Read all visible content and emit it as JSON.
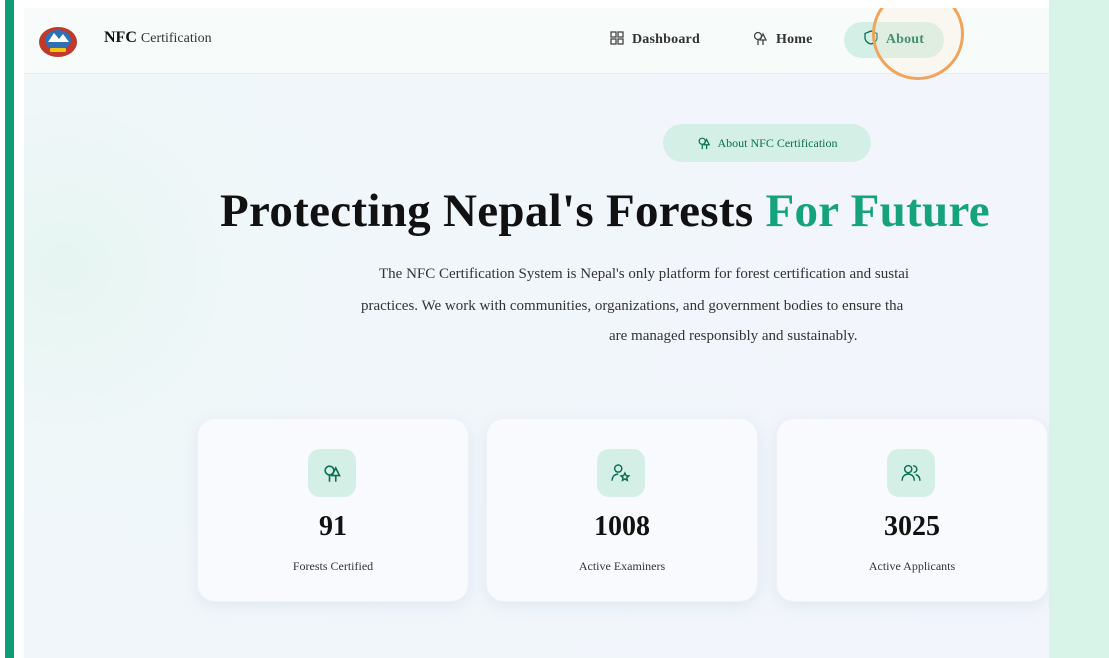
{
  "header": {
    "brand_bold": "NFC",
    "brand_rest": "Certification",
    "nav": [
      {
        "label": "Dashboard",
        "icon": "grid-icon"
      },
      {
        "label": "Home",
        "icon": "trees-icon"
      },
      {
        "label": "About",
        "icon": "shield-icon",
        "active": true
      }
    ]
  },
  "hero": {
    "pill": "About NFC Certification",
    "title_main": "Protecting Nepal's Forests",
    "title_accent": "For Future",
    "desc_line1": "The NFC Certification System is Nepal's only platform for forest certification and sustai",
    "desc_line2": "practices. We work with communities, organizations, and government bodies to ensure tha",
    "desc_line3": "are managed responsibly and sustainably."
  },
  "stats": [
    {
      "value": "91",
      "label": "Forests Certified",
      "icon": "trees-icon"
    },
    {
      "value": "1008",
      "label": "Active Examiners",
      "icon": "user-star-icon"
    },
    {
      "value": "3025",
      "label": "Active Applicants",
      "icon": "users-icon"
    }
  ],
  "colors": {
    "accent": "#14a37c",
    "accent_dark": "#0a6f53",
    "pill_bg": "#d4efe6",
    "side_accent": "#0f9b76",
    "cursor_ring": "#f0a35a"
  }
}
